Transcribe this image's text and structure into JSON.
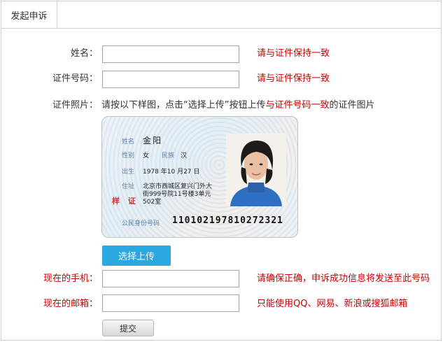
{
  "tab": {
    "label": "发起申诉"
  },
  "form": {
    "name": {
      "label": "姓名：",
      "value": "",
      "hint": "请与证件保持一致"
    },
    "id_number": {
      "label": "证件号码：",
      "value": "",
      "hint": "请与证件保持一致"
    },
    "photo": {
      "label": "证件照片：",
      "desc_before": "请按以下样图，点击“选择上传”按钮上传",
      "desc_red": "与证件号码一致",
      "desc_after": "的证件图片"
    },
    "upload_label": "选择上传",
    "phone": {
      "label_red": "现在的手机",
      "label_tail": "：",
      "value": "",
      "hint": "请确保正确，申诉成功信息将发送至此号码"
    },
    "email": {
      "label_red": "现在的邮箱",
      "label_tail": "：",
      "value": "",
      "hint": "只能使用QQ、网易、新浪或搜狐邮箱"
    },
    "submit_label": "提交"
  },
  "sample_card": {
    "name_key": "姓名",
    "name_value": "金阳",
    "gender_key": "性别",
    "gender_value": "女",
    "ethnicity_key": "民族",
    "ethnicity_value": "汉",
    "birth_key": "出生",
    "birth_value": "1978 年10 月27 日",
    "address_key": "住址",
    "address_line1": "北京市西城区复兴门外大",
    "address_line2": "街999号院11号楼3单元",
    "address_line3": "502室",
    "seal_text": "样 证",
    "id_key": "公民身份号码",
    "id_value": "110102197810272321"
  },
  "colors": {
    "accent_blue": "#29a9e0",
    "hint_red": "#cc0000"
  }
}
